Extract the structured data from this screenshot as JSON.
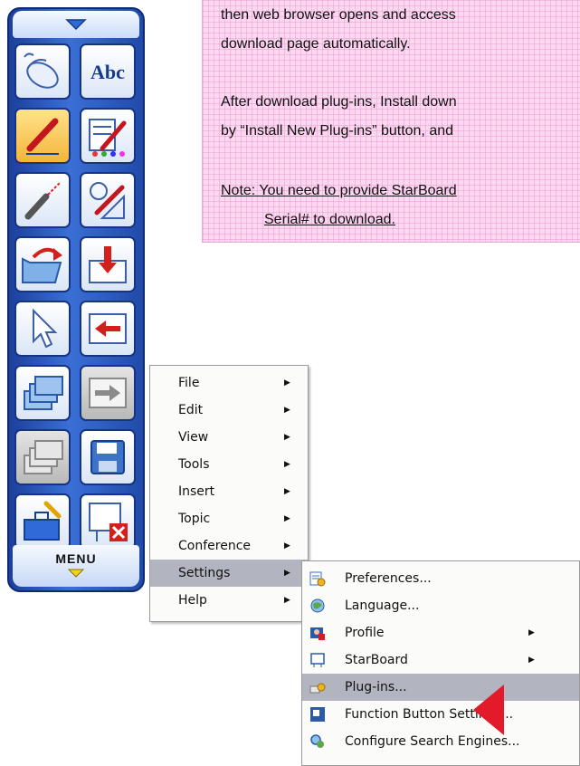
{
  "note": {
    "line1": "then web browser opens and access",
    "line2": "download page automatically.",
    "line3": "After download plug-ins, Install down",
    "line4": "by “Install New Plug-ins” button, and",
    "line5": "Note: You need to provide StarBoard",
    "line6": "Serial# to download."
  },
  "toolbar": {
    "menu_label": "MENU",
    "tools": [
      "mouse-icon",
      "text-abc-icon",
      "pen-icon",
      "pen-settings-icon",
      "laser-pointer-icon",
      "shape-pen-icon",
      "open-folder-icon",
      "import-icon",
      "select-arrow-icon",
      "back-icon",
      "stack-pages-icon",
      "next-page-icon",
      "stack-pages-disabled-icon",
      "save-icon",
      "toolbox-icon",
      "close-board-icon"
    ]
  },
  "main_menu": {
    "items": [
      {
        "label": "File",
        "has_submenu": true
      },
      {
        "label": "Edit",
        "has_submenu": true
      },
      {
        "label": "View",
        "has_submenu": true
      },
      {
        "label": "Tools",
        "has_submenu": true
      },
      {
        "label": "Insert",
        "has_submenu": true
      },
      {
        "label": "Topic",
        "has_submenu": true
      },
      {
        "label": "Conference",
        "has_submenu": true
      },
      {
        "label": "Settings",
        "has_submenu": true,
        "highlighted": true
      },
      {
        "label": "Help",
        "has_submenu": true
      }
    ]
  },
  "settings_menu": {
    "items": [
      {
        "label": "Preferences...",
        "icon": "preferences-icon"
      },
      {
        "label": "Language...",
        "icon": "language-icon"
      },
      {
        "label": "Profile",
        "icon": "profile-icon",
        "has_submenu": true
      },
      {
        "label": "StarBoard",
        "icon": "starboard-icon",
        "has_submenu": true
      },
      {
        "label": "Plug-ins...",
        "icon": "plugins-icon",
        "highlighted": true
      },
      {
        "label": "Function Button Settings...",
        "icon": "function-button-icon"
      },
      {
        "label": "Configure Search Engines...",
        "icon": "search-engine-icon"
      }
    ]
  },
  "colors": {
    "highlight": "#b2b4bf",
    "pointer": "#e21b2b",
    "note_bg": "#fcd7f0",
    "toolbar_blue": "#2a5cc4"
  }
}
